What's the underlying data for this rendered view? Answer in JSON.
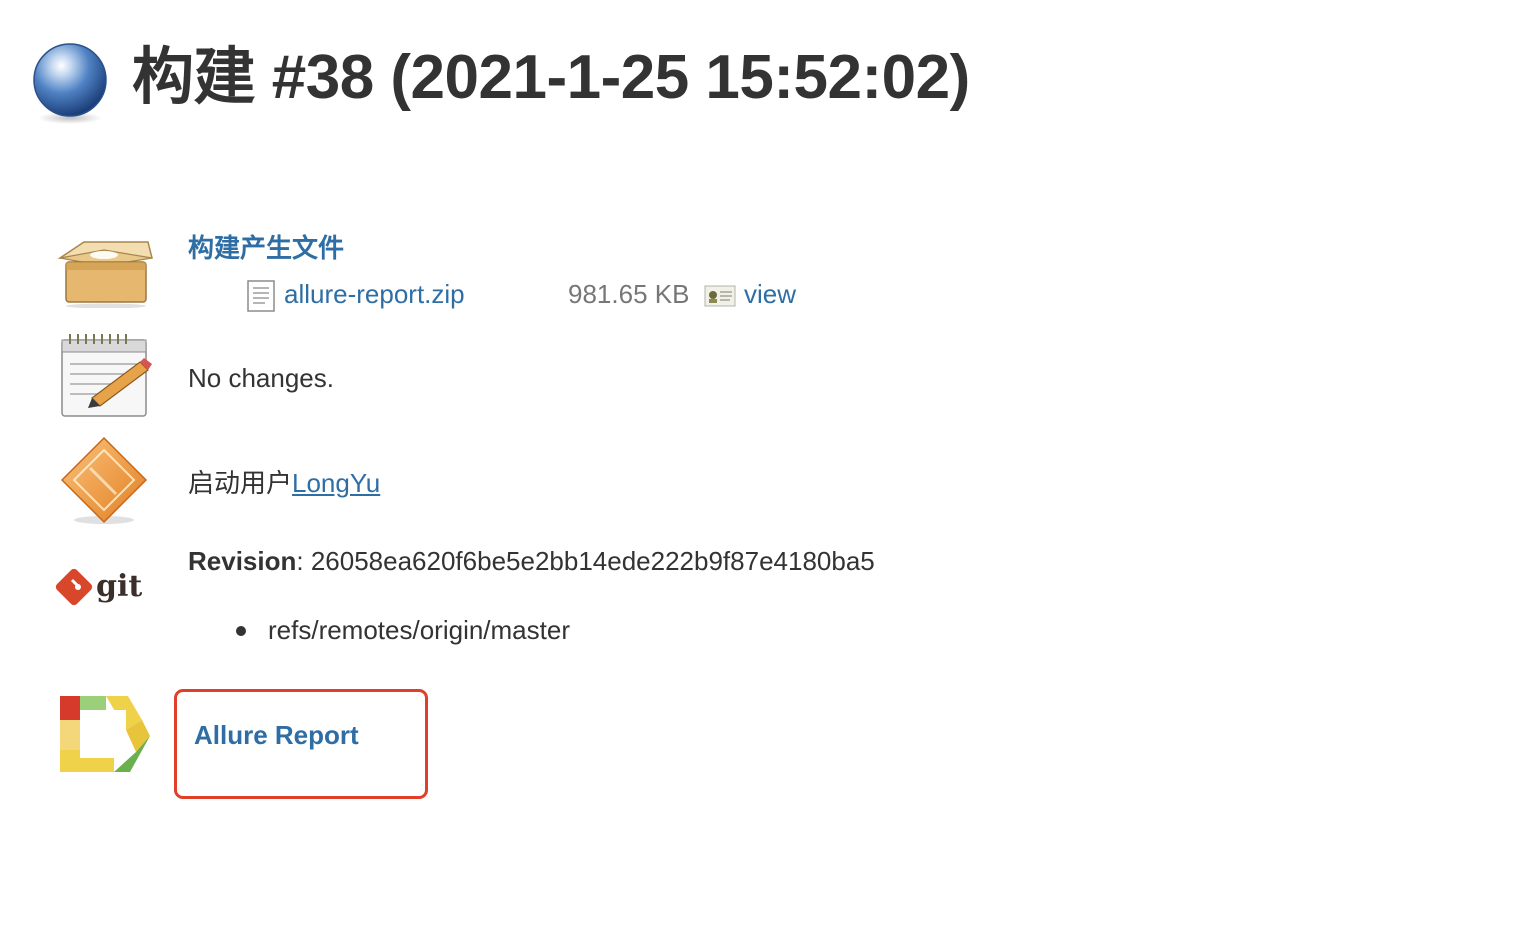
{
  "build": {
    "title": "构建 #38 (2021-1-25 15:52:02)",
    "status_icon": "blue-ball-icon"
  },
  "artifacts": {
    "icon": "package-box-icon",
    "heading": "构建产生文件",
    "items": [
      {
        "file_icon": "document-icon",
        "name": "allure-report.zip",
        "size": "981.65 KB",
        "view_icon": "fingerprint-icon",
        "view_label": "view"
      }
    ]
  },
  "changes": {
    "icon": "notepad-pencil-icon",
    "text": "No changes."
  },
  "cause": {
    "icon": "user-cause-icon",
    "prefix": "启动用户",
    "user": "LongYu"
  },
  "git": {
    "icon": "git-logo-icon",
    "revision_label": "Revision",
    "revision_separator": ": ",
    "revision": "26058ea620f6be5e2bb14ede222b9f87e4180ba5",
    "branches": [
      "refs/remotes/origin/master"
    ]
  },
  "allure": {
    "icon": "allure-logo-icon",
    "label": "Allure Report",
    "highlight_color": "#e0402a"
  },
  "colors": {
    "link": "#2f6ea5",
    "text": "#333333",
    "muted": "#777777"
  }
}
